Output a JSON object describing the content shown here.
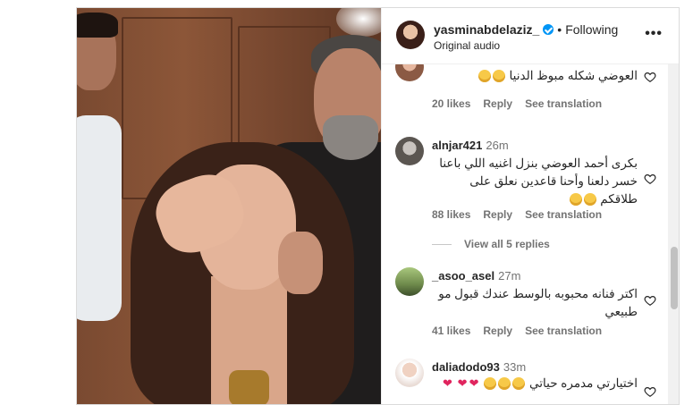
{
  "post": {
    "username": "yasminabdelaziz_",
    "follow_label": "Following",
    "audio_label": "Original audio",
    "more_label": "•••"
  },
  "comments": [
    {
      "username": "",
      "time": "",
      "text": "العوضي شكله مبوظ الدنيا",
      "emoji_count": 2,
      "likes": "20 likes",
      "reply": "Reply",
      "translate": "See translation"
    },
    {
      "username": "alnjar421",
      "time": "26m",
      "text": "بكرى أحمد العوضي بنزل اغنيه اللي باعنا خسر دلعنا وأحنا قاعدين نعلق على طلاقكم",
      "emoji_count": 2,
      "likes": "88 likes",
      "reply": "Reply",
      "translate": "See translation",
      "view_replies": "View all 5 replies"
    },
    {
      "username": "_asoo_asel",
      "time": "27m",
      "text": "اكتر فنانه محبوبه بالوسط عندك قبول مو طبيعي",
      "likes": "41 likes",
      "reply": "Reply",
      "translate": "See translation"
    },
    {
      "username": "daliadodo93",
      "time": "33m",
      "text": "اختيارتي مدمره حياتي"
    }
  ],
  "icons": {
    "heart": "heart-outline-icon",
    "verified": "verified-badge-icon",
    "more": "more-horizontal-icon"
  },
  "colors": {
    "verified": "#0095f6",
    "text": "#262626",
    "muted": "#737373"
  }
}
